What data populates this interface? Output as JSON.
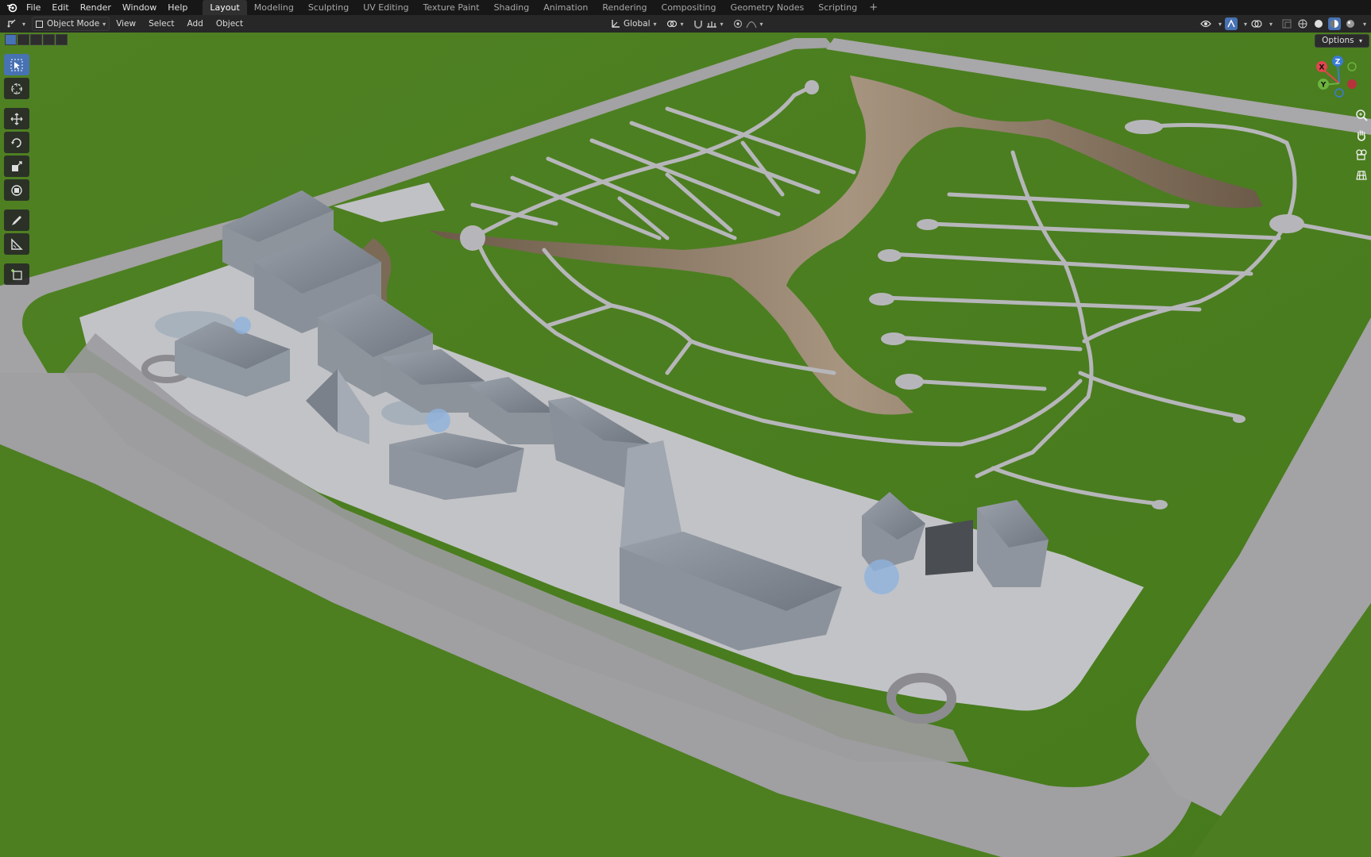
{
  "menu": {
    "items": [
      "File",
      "Edit",
      "Render",
      "Window",
      "Help"
    ]
  },
  "workspaces": {
    "tabs": [
      "Layout",
      "Modeling",
      "Sculpting",
      "UV Editing",
      "Texture Paint",
      "Shading",
      "Animation",
      "Rendering",
      "Compositing",
      "Geometry Nodes",
      "Scripting"
    ],
    "active": "Layout",
    "add_label": "+"
  },
  "header": {
    "mode": "Object Mode",
    "menus": [
      "View",
      "Select",
      "Add",
      "Object"
    ],
    "transform_orientation": "Global"
  },
  "viewport": {
    "options_label": "Options",
    "gizmo": {
      "x": "X",
      "y": "Y",
      "z": "Z"
    }
  },
  "colors": {
    "grass": "#4b7d1f",
    "road": "#9a999b",
    "path": "#b9b9bd",
    "accent": "#4772b3"
  },
  "icons": {
    "toolbar": [
      "select-box-icon",
      "cursor-icon",
      "move-icon",
      "rotate-icon",
      "scale-icon",
      "transform-icon",
      "annotate-icon",
      "measure-icon",
      "add-cube-icon"
    ],
    "nav": [
      "zoom-icon",
      "pan-hand-icon",
      "camera-icon",
      "grid-ortho-icon"
    ]
  }
}
